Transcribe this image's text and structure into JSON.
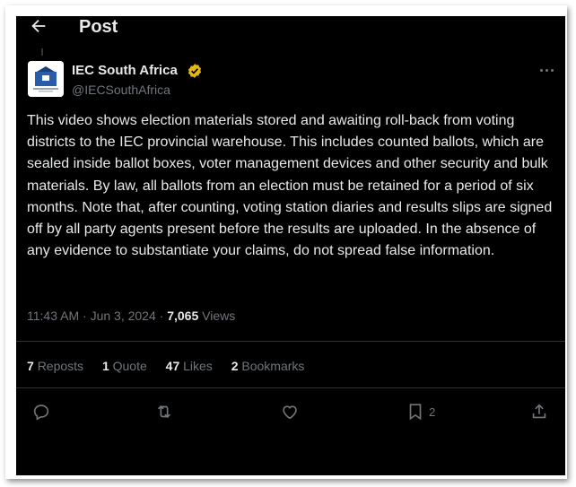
{
  "header": {
    "title": "Post"
  },
  "author": {
    "name": "IEC South Africa",
    "handle": "@IECSouthAfrica",
    "verified_color": "#e2b719"
  },
  "tweet": {
    "text": "This video shows election materials stored and awaiting roll-back from voting districts to the IEC provincial warehouse. This includes counted ballots, which are sealed inside ballot boxes, voter management devices and other security and bulk materials. By law, all ballots from an election must be retained for a period of six months. Note that, after counting, voting station diaries and results slips are signed off by all party agents present before the results are uploaded. In the absence of any evidence to substantiate your claims, do not spread false information."
  },
  "meta": {
    "time": "11:43 AM",
    "date": "Jun 3, 2024",
    "views_count": "7,065",
    "views_label": "Views"
  },
  "stats": {
    "reposts_count": "7",
    "reposts_label": "Reposts",
    "quotes_count": "1",
    "quotes_label": "Quote",
    "likes_count": "47",
    "likes_label": "Likes",
    "bookmarks_count": "2",
    "bookmarks_label": "Bookmarks"
  },
  "actions": {
    "reply_icon": "reply-icon",
    "repost_icon": "repost-icon",
    "like_icon": "heart-icon",
    "bookmark_icon": "bookmark-icon",
    "bookmark_count": "2",
    "share_icon": "share-icon"
  },
  "colors": {
    "background": "#000000",
    "text": "#e7e9ea",
    "muted": "#71767b",
    "divider": "#2f3336"
  }
}
